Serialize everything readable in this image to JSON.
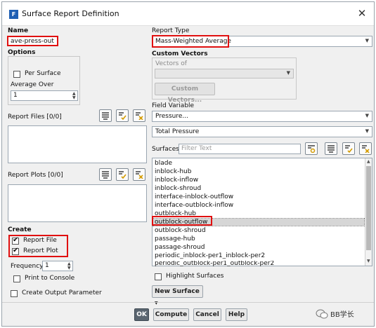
{
  "window": {
    "title": "Surface Report Definition",
    "close_icon": "close-icon",
    "app_icon": "F"
  },
  "left": {
    "name_label": "Name",
    "name_value": "ave-press-out",
    "options_label": "Options",
    "per_surface_label": "Per Surface",
    "average_over_label": "Average Over",
    "average_over_value": "1",
    "report_files_label": "Report Files [0/0]",
    "report_plots_label": "Report Plots [0/0]",
    "create_label": "Create",
    "report_file_label": "Report File",
    "report_plot_label": "Report Plot",
    "frequency_label": "Frequency",
    "frequency_value": "1",
    "print_to_console_label": "Print to Console",
    "create_output_parameter_label": "Create Output Parameter"
  },
  "right": {
    "report_type_label": "Report Type",
    "report_type_value": "Mass-Weighted Average",
    "custom_vectors_label": "Custom Vectors",
    "vectors_of_label": "Vectors of",
    "vectors_of_value": "",
    "custom_vectors_button": "Custom Vectors...",
    "field_variable_label": "Field Variable",
    "field_category_value": "Pressure...",
    "field_variable_value": "Total Pressure",
    "surfaces_label": "Surfaces",
    "filter_placeholder": "Filter Text",
    "surfaces": [
      "blade",
      "inblock-hub",
      "inblock-inflow",
      "inblock-shroud",
      "interface-inblock-outflow",
      "interface-outblock-inflow",
      "outblock-hub",
      "outblock-outflow",
      "outblock-shroud",
      "passage-hub",
      "passage-shroud",
      "periodic_inblock-per1_inblock-per2",
      "periodic_outblock-per1_outblock-per2"
    ],
    "selected_surface": "outblock-outflow",
    "highlight_surfaces_label": "Highlight Surfaces",
    "new_surface_button": "New Surface"
  },
  "footer": {
    "ok": "OK",
    "compute": "Compute",
    "cancel": "Cancel",
    "help": "Help"
  },
  "watermark": "BB学长",
  "colors": {
    "highlight_box": "#e01010",
    "ok_button": "#5a6570"
  }
}
